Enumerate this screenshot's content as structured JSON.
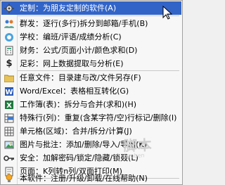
{
  "menu": {
    "items": [
      {
        "label": "定制：为朋友定制的软件(A)",
        "icon": "gear-icon",
        "active": true
      },
      {
        "label": "群发：逐行(多行)拆分到邮箱/手机(B)",
        "icon": "people-icon"
      },
      {
        "label": "学校：编班/评语/成绩分析(C)",
        "icon": "school-icon"
      },
      {
        "label": "财务：公式/页面小计/颜色求和(D)",
        "icon": "finance-icon"
      },
      {
        "label": "足彩：网上数据提取与分析(E)",
        "icon": "dollar-icon"
      },
      {
        "label": "任意文件：目录建与改/文件另存(F)",
        "icon": "folder-icon"
      },
      {
        "label": "Word/Excel：表格相互转化(G)",
        "icon": "word-icon"
      },
      {
        "label": "工作簿(表)：拆分与合并(求和)(H)",
        "icon": "excel-icon"
      },
      {
        "label": "特殊行(列)：重复(含某字符/空)行标记/删除(I)",
        "icon": "rows-icon"
      },
      {
        "label": "单元格(区域)：合并/拆分/计算(J)",
        "icon": "cells-icon"
      },
      {
        "label": "图片与批注：添加/删除/导入/导出(K)",
        "icon": "picture-icon"
      },
      {
        "label": "安全：加解密码/锁定/隐藏/锁叕(L)",
        "icon": "key-icon"
      },
      {
        "label": "页面：K列转n列/双面打印(M)",
        "icon": "page-icon"
      },
      {
        "label": "本软件：注册/升级/卸载/在线帮助(N)",
        "icon": "bulb-icon"
      }
    ]
  },
  "watermark": {
    "main": "脚本",
    "sub": "jiaoben"
  },
  "colors": {
    "highlight": "#3264c8"
  }
}
